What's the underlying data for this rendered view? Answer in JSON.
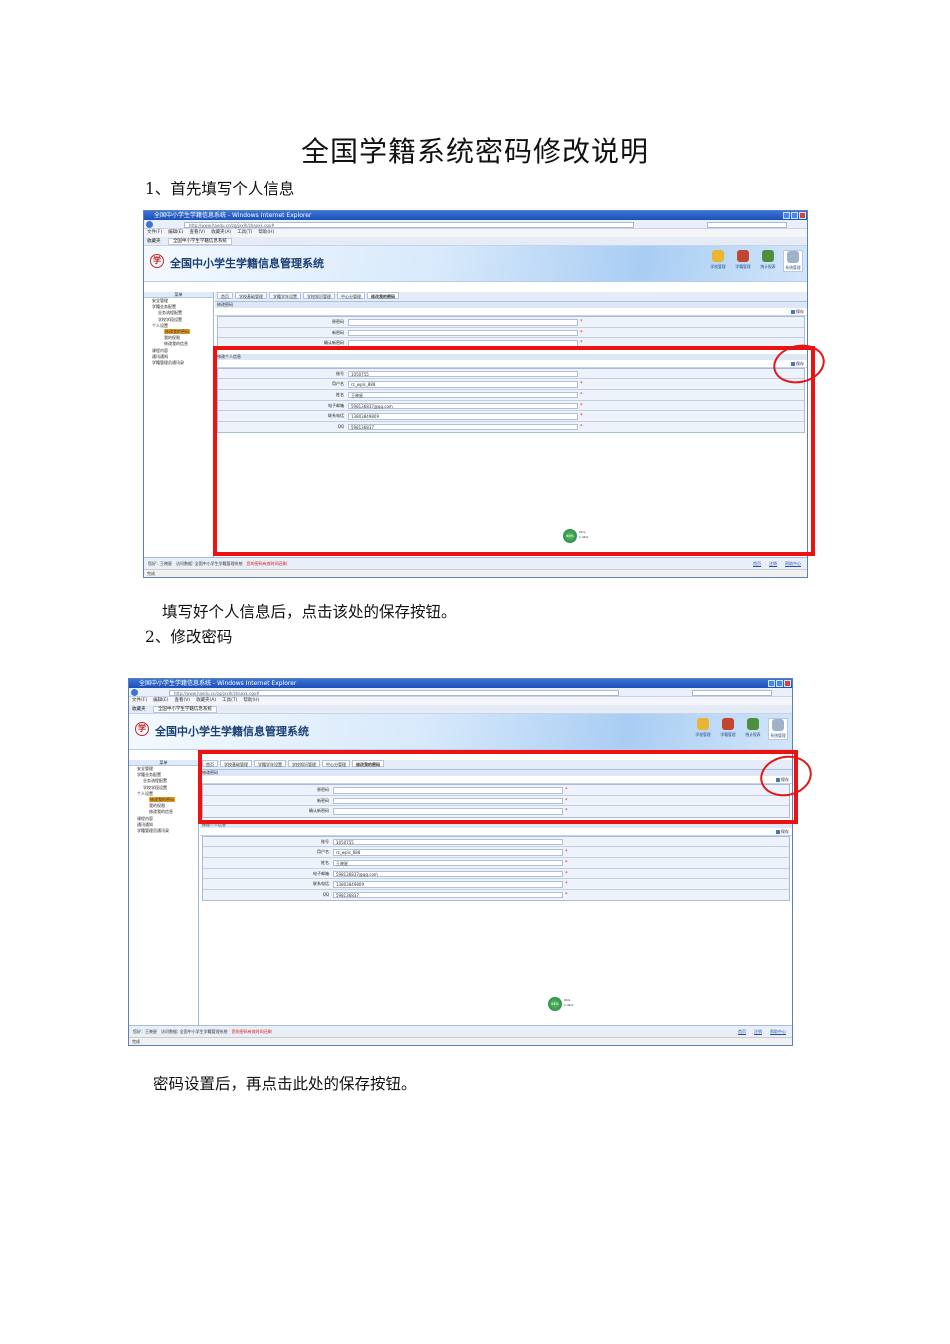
{
  "doc": {
    "title": "全国学籍系统密码修改说明",
    "step1_heading": "1、首先填写个人信息",
    "step1_caption": "填写好个人信息后，点击该处的保存按钮。",
    "step2_heading": "2、修改密码",
    "step2_caption": "密码设置后，再点击此处的保存按钮。"
  },
  "screenshot": {
    "window_title": "全国中小学生学籍信息系统 - Windows Internet Explorer",
    "url_text": "http://www.haedu.cn/zg/jxxlh/zhaoxk.cgx#",
    "menu": [
      "文件(F)",
      "编辑(E)",
      "查看(V)",
      "收藏夹(A)",
      "工具(T)",
      "帮助(H)"
    ],
    "favorites_label": "收藏夹",
    "browser_tab": "全国中小学生学籍信息系统",
    "system_name": "全国中小学生学籍信息管理系统",
    "logo_char": "学",
    "header_icons": [
      {
        "label": "学校管理",
        "color": "#e9b634"
      },
      {
        "label": "学籍管理",
        "color": "#c2462f"
      },
      {
        "label": "统计报表",
        "color": "#4c8f3c"
      },
      {
        "label": "系统管理",
        "color": "#9fb2c8"
      }
    ],
    "sidebar_head": "菜单",
    "sidebar_items": [
      {
        "text": "安全管理",
        "level": "l1"
      },
      {
        "text": "学籍业务配置",
        "level": "l1"
      },
      {
        "text": "业务流程配置",
        "level": "l2"
      },
      {
        "text": "学校学段设置",
        "level": "l2"
      },
      {
        "text": "个人设置",
        "level": "l1"
      },
      {
        "text": "修改我的密码",
        "level": "l3",
        "highlight": true
      },
      {
        "text": "我的权限",
        "level": "l3"
      },
      {
        "text": "修改我的信息",
        "level": "l3"
      },
      {
        "text": "课程内容",
        "level": "l1"
      },
      {
        "text": "通讯通知",
        "level": "l1"
      },
      {
        "text": "学籍管理员通讯录",
        "level": "l1"
      }
    ],
    "tabs": [
      "首页",
      "学校基础管理",
      "学籍学年设置",
      "学校知识管理",
      "中心分管理",
      "修改我的密码"
    ],
    "password_section": "修改密码",
    "password_fields": [
      "原密码",
      "新密码",
      "确认新密码"
    ],
    "info_section": "修改个人信息",
    "info_fields": [
      {
        "label": "账号",
        "value": "1050755",
        "star": false
      },
      {
        "label": "用户名",
        "value": "rz_wpls_888",
        "star": true
      },
      {
        "label": "姓名",
        "value": "王晓星",
        "star": true
      },
      {
        "label": "电子邮箱",
        "value": "598136837@qq.com",
        "star": true
      },
      {
        "label": "联系电话",
        "value": "13803849809",
        "star": true
      },
      {
        "label": "QQ",
        "value": "598136837",
        "star": true
      }
    ],
    "save_label": "保存",
    "status_left": "您好：王晓星　访问数据: 全国中小学生学籍管理系统",
    "status_warn": "您的密码有效时间还剩",
    "status_right": [
      "首页",
      "注销",
      "帮助中心"
    ],
    "done_text": "完成",
    "badge_percent": "64%",
    "badge_lines": [
      "0K/s",
      "1.4K/s"
    ],
    "annotation_color": "#ee1111"
  }
}
